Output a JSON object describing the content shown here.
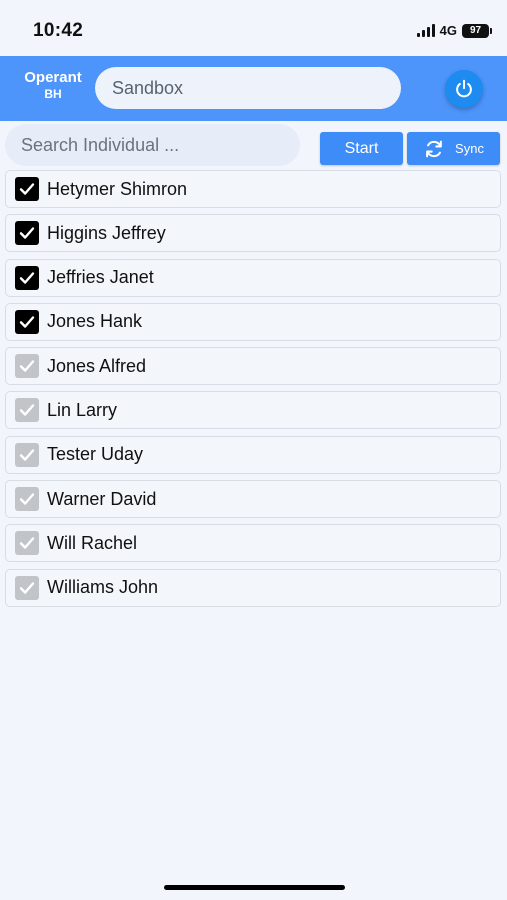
{
  "status_bar": {
    "time": "10:42",
    "network": "4G",
    "battery": "97"
  },
  "header": {
    "brand_name": "Operant",
    "brand_sub": "BH",
    "environment": "Sandbox",
    "power_icon": "power-icon",
    "accent_color": "#4d94fb"
  },
  "search": {
    "placeholder": "Search Individual ..."
  },
  "actions": {
    "start_label": "Start",
    "sync_label": "Sync",
    "sync_icon": "sync-icon"
  },
  "individuals": [
    {
      "name": "Hetymer Shimron",
      "state": "checked"
    },
    {
      "name": "Higgins Jeffrey",
      "state": "checked"
    },
    {
      "name": "Jeffries Janet",
      "state": "checked"
    },
    {
      "name": "Jones Hank",
      "state": "checked"
    },
    {
      "name": "Jones Alfred",
      "state": "disabled"
    },
    {
      "name": "Lin Larry",
      "state": "disabled"
    },
    {
      "name": "Tester Uday",
      "state": "disabled"
    },
    {
      "name": "Warner David",
      "state": "disabled"
    },
    {
      "name": "Will Rachel",
      "state": "disabled"
    },
    {
      "name": "Williams John",
      "state": "disabled"
    }
  ]
}
